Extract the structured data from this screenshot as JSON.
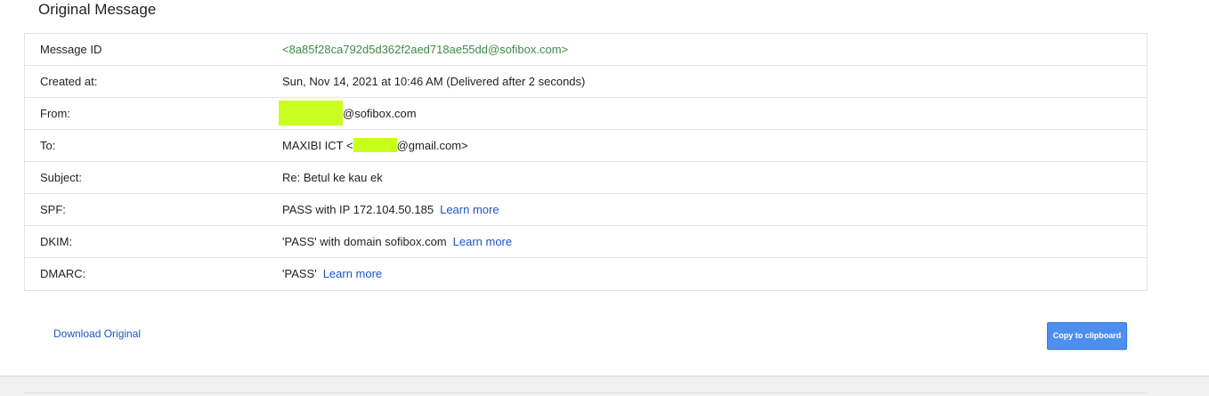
{
  "page": {
    "title": "Original Message"
  },
  "details": {
    "message_id": {
      "label": "Message ID",
      "value": "<8a85f28ca792d5d362f2aed718ae55dd@sofibox.com>"
    },
    "created_at": {
      "label": "Created at:",
      "value": "Sun, Nov 14, 2021 at 10:46 AM (Delivered after 2 seconds)"
    },
    "from": {
      "label": "From:",
      "suffix": "@sofibox.com"
    },
    "to": {
      "label": "To:",
      "prefix": "MAXIBI ICT <",
      "suffix": "@gmail.com>"
    },
    "subject": {
      "label": "Subject:",
      "value": "Re: Betul ke kau ek"
    },
    "spf": {
      "label": "SPF:",
      "value": "PASS with IP 172.104.50.185",
      "link": "Learn more"
    },
    "dkim": {
      "label": "DKIM:",
      "value": "'PASS' with domain sofibox.com",
      "link": "Learn more"
    },
    "dmarc": {
      "label": "DMARC:",
      "value": "'PASS'",
      "link": "Learn more"
    }
  },
  "actions": {
    "download_label": "Download Original",
    "copy_label": "Copy to clipboard"
  },
  "colors": {
    "message_id_text": "#3d8b45",
    "link": "#1a56c4",
    "redaction_highlight": "#c8ff1e",
    "primary_button": "#4d8ff0"
  }
}
